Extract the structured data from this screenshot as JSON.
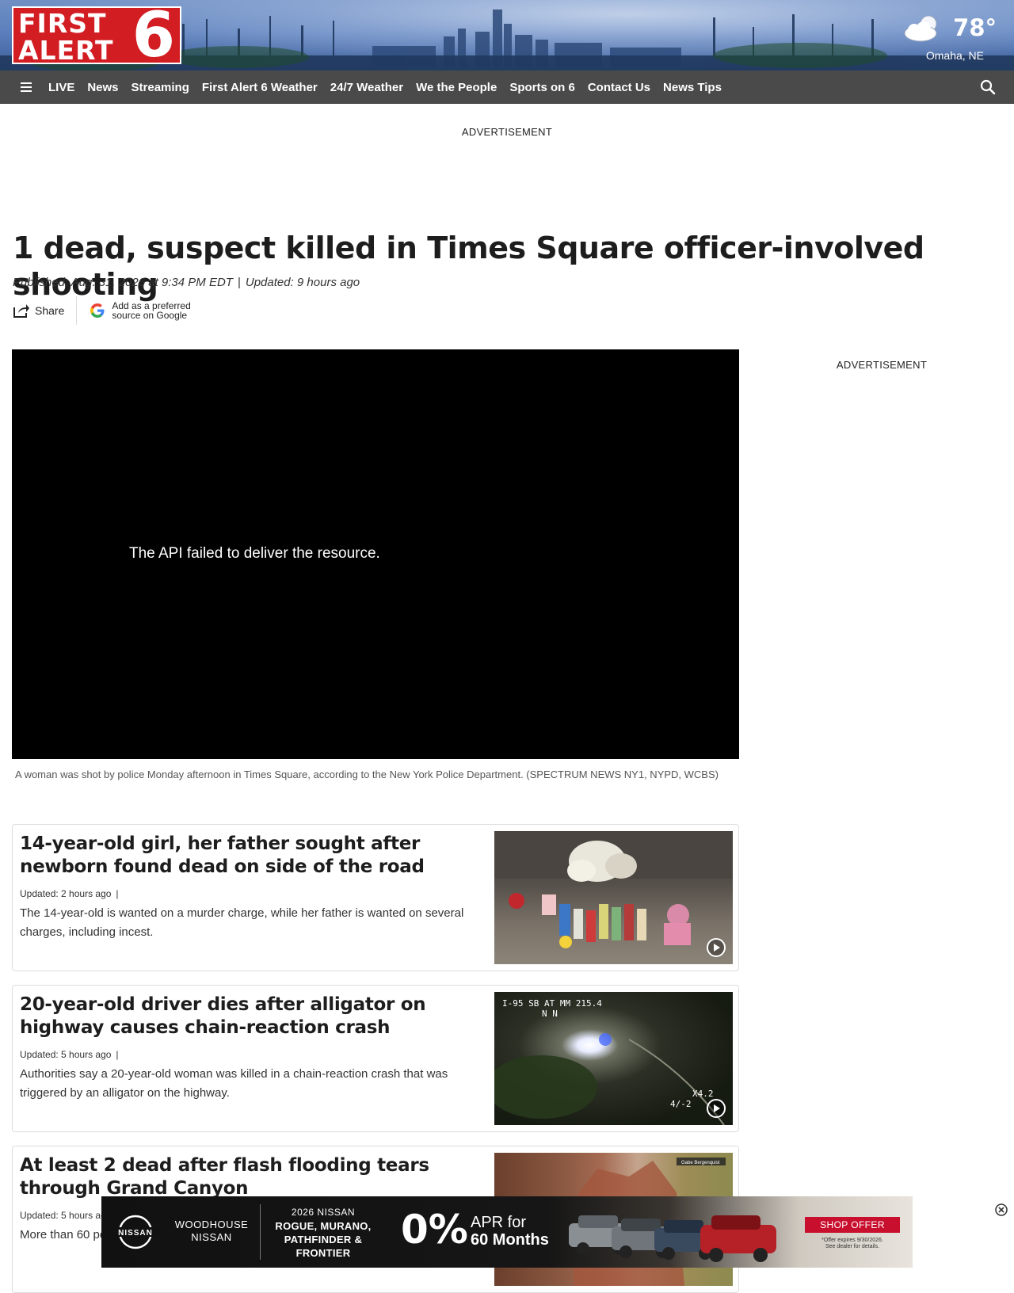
{
  "header": {
    "logo": {
      "line1": "FIRST",
      "line2": "ALERT",
      "number": "6"
    },
    "weather": {
      "temperature": "78°",
      "location": "Omaha, NE",
      "icon": "partly-cloudy-icon"
    }
  },
  "nav": {
    "menu_icon": "hamburger-menu-icon",
    "items": [
      "LIVE",
      "News",
      "Streaming",
      "First Alert 6 Weather",
      "24/7 Weather",
      "We the People",
      "Sports on 6",
      "Contact Us",
      "News Tips"
    ],
    "search_icon": "search-icon"
  },
  "ads": {
    "top_label": "ADVERTISEMENT",
    "side_label": "ADVERTISEMENT"
  },
  "article": {
    "headline": "1 dead, suspect killed in Times Square officer-involved shooting",
    "published": "Published: Aug. 31, 2026 at 9:34 PM EDT",
    "separator": "|",
    "updated": "Updated: 9 hours ago",
    "share_label": "Share",
    "google_line1": "Add as a preferred",
    "google_line2": "source on Google",
    "video_error": "The API failed to deliver the resource.",
    "caption": "A woman was shot by police Monday afternoon in Times Square, according to the New York Police Department. (SPECTRUM NEWS NY1, NYPD, WCBS)"
  },
  "related": [
    {
      "title": "14-year-old girl, her father sought after newborn found dead on side of the road",
      "updated": "Updated: 2 hours ago",
      "bar": "|",
      "description": "The 14-year-old is wanted on a murder charge, while her father is wanted on several charges, including incest."
    },
    {
      "title": "20-year-old driver dies after alligator on highway causes chain-reaction crash",
      "updated": "Updated: 5 hours ago",
      "bar": "|",
      "description": "Authorities say a 20-year-old woman was killed in a chain-reaction crash that was triggered by an alligator on the highway.",
      "thumb_overlay_top": "I-95  SB  AT  MM  215.4",
      "thumb_overlay_sub": "N     N",
      "thumb_overlay_bottom1": "X4.2",
      "thumb_overlay_bottom2": "4/-2"
    },
    {
      "title": "At least 2 dead after flash flooding tears through Grand Canyon",
      "updated": "Updated: 5 hours ago",
      "bar": "|",
      "description": "More than 60 people were evacuated after the flash flood.",
      "thumb_credit": "Gabe Bergenquist"
    }
  ],
  "banner_ad": {
    "dealer_line1": "WOODHOUSE",
    "dealer_line2": "NISSAN",
    "brand": "NISSAN",
    "year": "2026 NISSAN",
    "models_line1": "ROGUE, MURANO,",
    "models_line2": "PATHFINDER &",
    "models_line3": "FRONTIER",
    "rate": "0%",
    "apr_line1": "APR for",
    "apr_line2": "60 Months",
    "cta": "SHOP OFFER",
    "fine1": "*Offer expires 9/30/2026.",
    "fine2": "See dealer for details.",
    "accent": "#c8102e"
  }
}
